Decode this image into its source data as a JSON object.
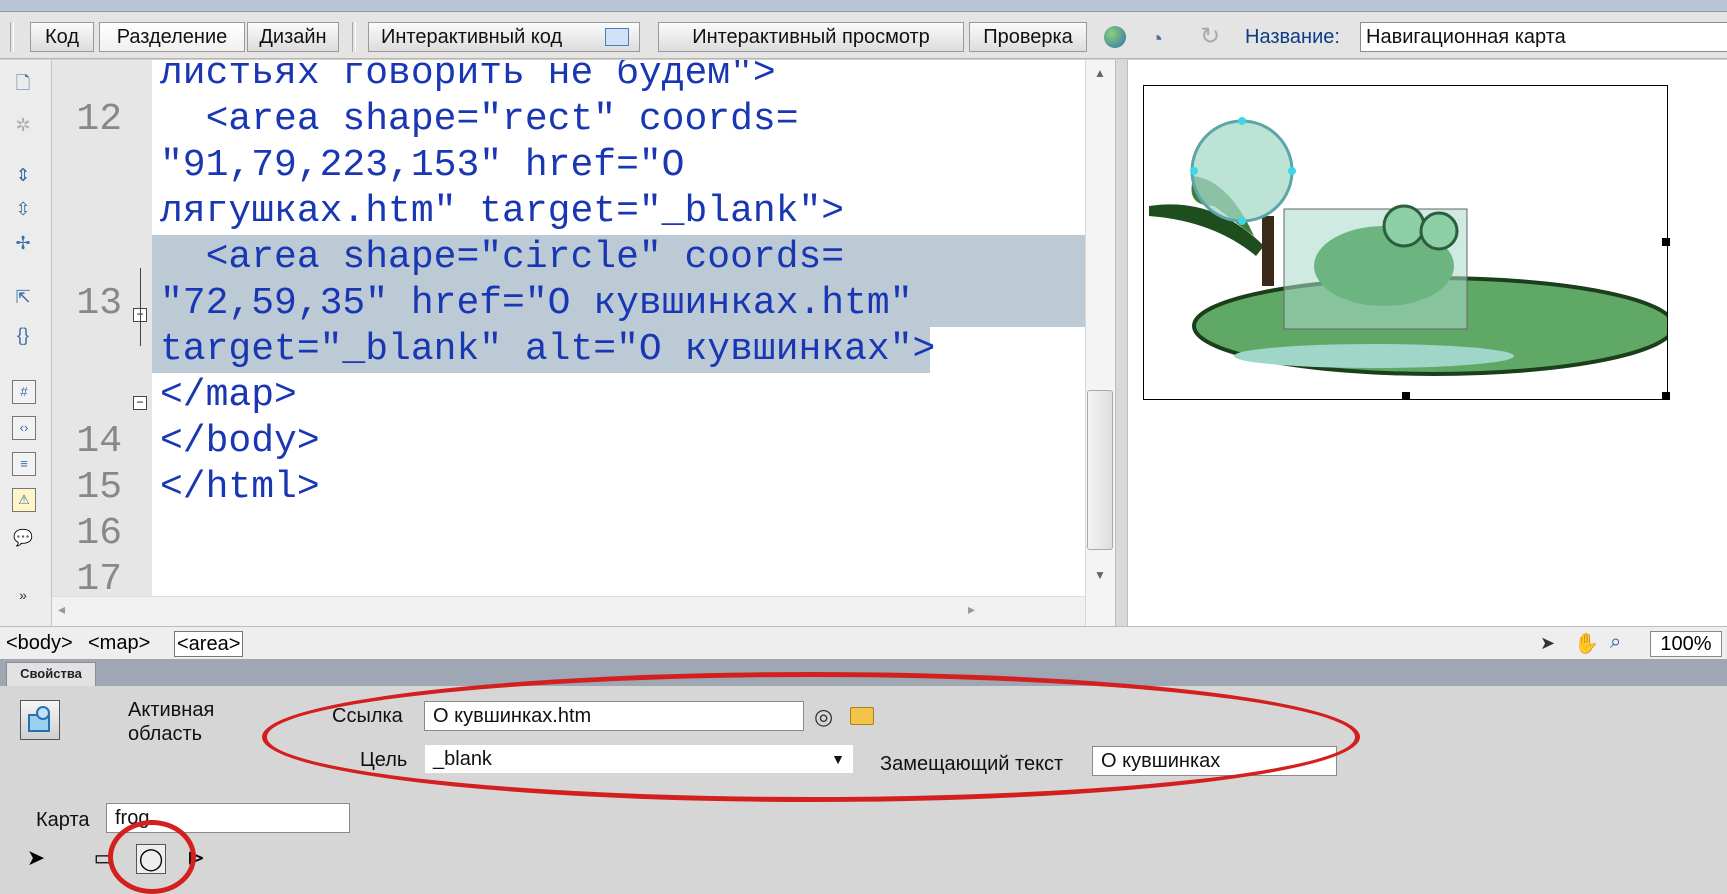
{
  "toolbar": {
    "view_code": "Код",
    "view_split": "Разделение",
    "view_design": "Дизайн",
    "live_code": "Интерактивный код",
    "live_view": "Интерактивный просмотр",
    "inspect": "Проверка",
    "title_label": "Название:",
    "title_value": "Навигационная карта"
  },
  "editor": {
    "line_numbers": [
      "12",
      "13",
      "14",
      "15",
      "16",
      "17"
    ],
    "lines": [
      "листьях говорить не будем\">",
      "  <area shape=\"rect\" coords=",
      "\"91,79,223,153\" href=\"О",
      "лягушках.htm\" target=\"_blank\">",
      "  <area shape=\"circle\" coords=",
      "\"72,59,35\" href=\"О кувшинках.htm\"",
      "target=\"_blank\" alt=\"О кувшинках\">",
      "</map>",
      "</body>",
      "</html>"
    ]
  },
  "statusbar": {
    "tag_body": "<body>",
    "tag_map": "<map>",
    "tag_area": "<area>",
    "zoom": "100%"
  },
  "properties": {
    "tab_label": "Свойства",
    "element_type_line1": "Активная",
    "element_type_line2": "область",
    "link_label": "Ссылка",
    "link_value": "О кувшинках.htm",
    "target_label": "Цель",
    "target_value": "_blank",
    "alt_label": "Замещающий текст",
    "alt_value": "О кувшинках",
    "map_label": "Карта",
    "map_value": "frog"
  },
  "colors": {
    "highlight_oval": "#d3201f",
    "code_text": "#1a37b3",
    "selection": "#bccad6"
  }
}
